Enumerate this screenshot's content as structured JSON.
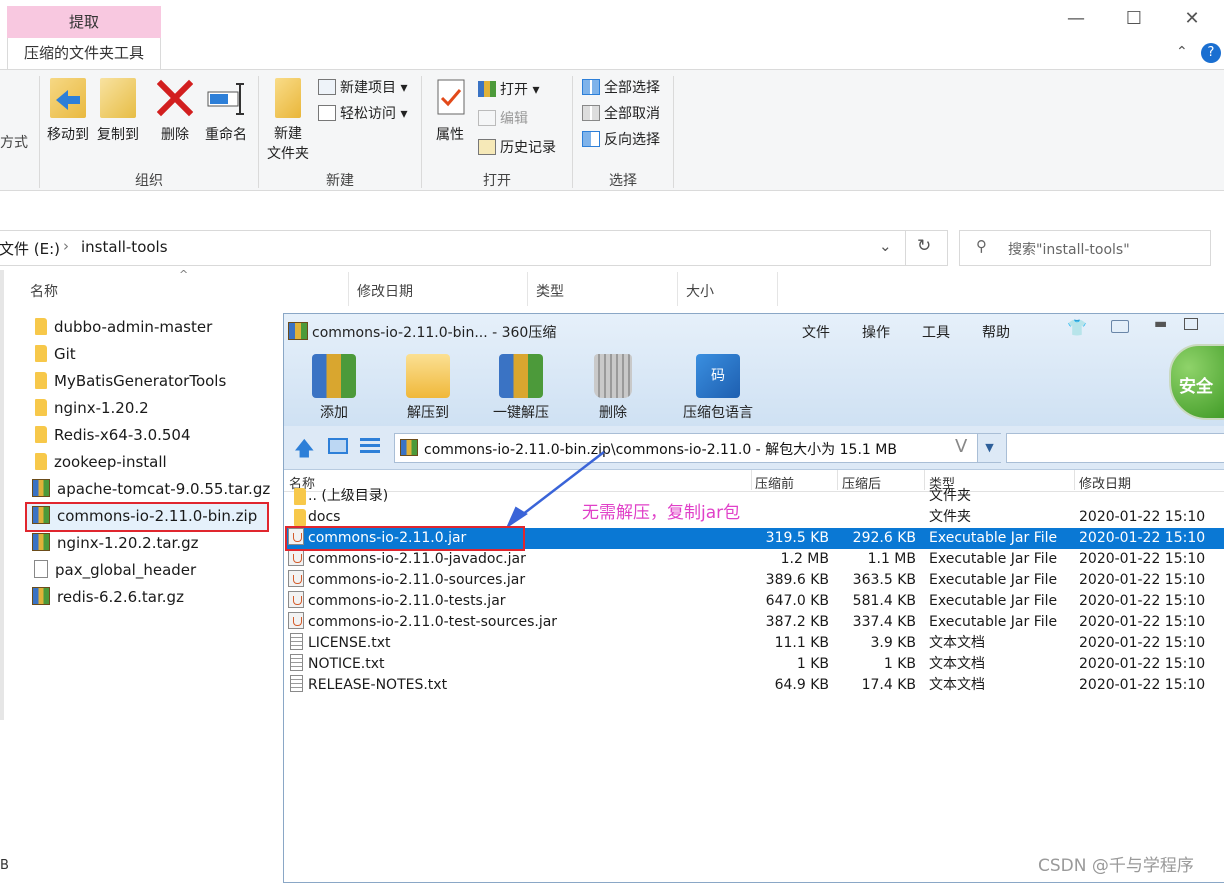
{
  "explorer": {
    "tab_extract": "提取",
    "tab_context": "压缩的文件夹工具",
    "ribbon": {
      "cut_label": "方式",
      "organize": {
        "move_to": "移动到",
        "copy_to": "复制到",
        "delete": "删除",
        "rename": "重命名",
        "group": "组织"
      },
      "new": {
        "new_folder_line1": "新建",
        "new_folder_line2": "文件夹",
        "new_item": "新建项目",
        "easy_access": "轻松访问",
        "group": "新建"
      },
      "open": {
        "properties": "属性",
        "open": "打开",
        "edit": "编辑",
        "history": "历史记录",
        "group": "打开"
      },
      "select": {
        "select_all": "全部选择",
        "select_none": "全部取消",
        "invert": "反向选择",
        "group": "选择"
      }
    },
    "address": {
      "drive": "文件 (E:)",
      "folder": "install-tools"
    },
    "search_placeholder": "搜索\"install-tools\"",
    "columns": {
      "name": "名称",
      "modified": "修改日期",
      "type": "类型",
      "size": "大小"
    },
    "files": [
      {
        "name": "dubbo-admin-master",
        "kind": "folder"
      },
      {
        "name": "Git",
        "kind": "folder"
      },
      {
        "name": "MyBatisGeneratorTools",
        "kind": "folder"
      },
      {
        "name": "nginx-1.20.2",
        "kind": "folder"
      },
      {
        "name": "Redis-x64-3.0.504",
        "kind": "folder"
      },
      {
        "name": "zookeep-install",
        "kind": "folder"
      },
      {
        "name": "apache-tomcat-9.0.55.tar.gz",
        "kind": "zip"
      },
      {
        "name": "commons-io-2.11.0-bin.zip",
        "kind": "zip"
      },
      {
        "name": "nginx-1.20.2.tar.gz",
        "kind": "zip"
      },
      {
        "name": "pax_global_header",
        "kind": "doc"
      },
      {
        "name": "redis-6.2.6.tar.gz",
        "kind": "zip"
      }
    ],
    "status_fragment": "B"
  },
  "zip360": {
    "title": "commons-io-2.11.0-bin... - 360压缩",
    "menu": [
      "文件",
      "操作",
      "工具",
      "帮助"
    ],
    "security_badge": "安全",
    "toolbar": [
      "添加",
      "解压到",
      "一键解压",
      "删除",
      "压缩包语言"
    ],
    "path": "commons-io-2.11.0-bin.zip\\commons-io-2.11.0 - 解包大小为 15.1 MB",
    "columns": {
      "name": "名称",
      "before": "压缩前",
      "after": "压缩后",
      "type": "类型",
      "modified": "修改日期"
    },
    "rows": [
      {
        "name": ".. (上级目录)",
        "before": "",
        "after": "",
        "type": "文件夹",
        "modified": ""
      },
      {
        "name": "docs",
        "before": "",
        "after": "",
        "type": "文件夹",
        "modified": "2020-01-22 15:10"
      },
      {
        "name": "commons-io-2.11.0.jar",
        "before": "319.5 KB",
        "after": "292.6 KB",
        "type": "Executable Jar File",
        "modified": "2020-01-22 15:10"
      },
      {
        "name": "commons-io-2.11.0-javadoc.jar",
        "before": "1.2 MB",
        "after": "1.1 MB",
        "type": "Executable Jar File",
        "modified": "2020-01-22 15:10"
      },
      {
        "name": "commons-io-2.11.0-sources.jar",
        "before": "389.6 KB",
        "after": "363.5 KB",
        "type": "Executable Jar File",
        "modified": "2020-01-22 15:10"
      },
      {
        "name": "commons-io-2.11.0-tests.jar",
        "before": "647.0 KB",
        "after": "581.4 KB",
        "type": "Executable Jar File",
        "modified": "2020-01-22 15:10"
      },
      {
        "name": "commons-io-2.11.0-test-sources.jar",
        "before": "387.2 KB",
        "after": "337.4 KB",
        "type": "Executable Jar File",
        "modified": "2020-01-22 15:10"
      },
      {
        "name": "LICENSE.txt",
        "before": "11.1 KB",
        "after": "3.9 KB",
        "type": "文本文档",
        "modified": "2020-01-22 15:10"
      },
      {
        "name": "NOTICE.txt",
        "before": "1 KB",
        "after": "1 KB",
        "type": "文本文档",
        "modified": "2020-01-22 15:10"
      },
      {
        "name": "RELEASE-NOTES.txt",
        "before": "64.9 KB",
        "after": "17.4 KB",
        "type": "文本文档",
        "modified": "2020-01-22 15:10"
      }
    ],
    "annotation": "无需解压，复制jar包"
  },
  "watermark": "CSDN @千与学程序",
  "colors": {
    "selection": "#0a78d4",
    "annotation": "#e040c8",
    "highlight_box": "#e0262e",
    "arrow": "#3a64d8"
  }
}
